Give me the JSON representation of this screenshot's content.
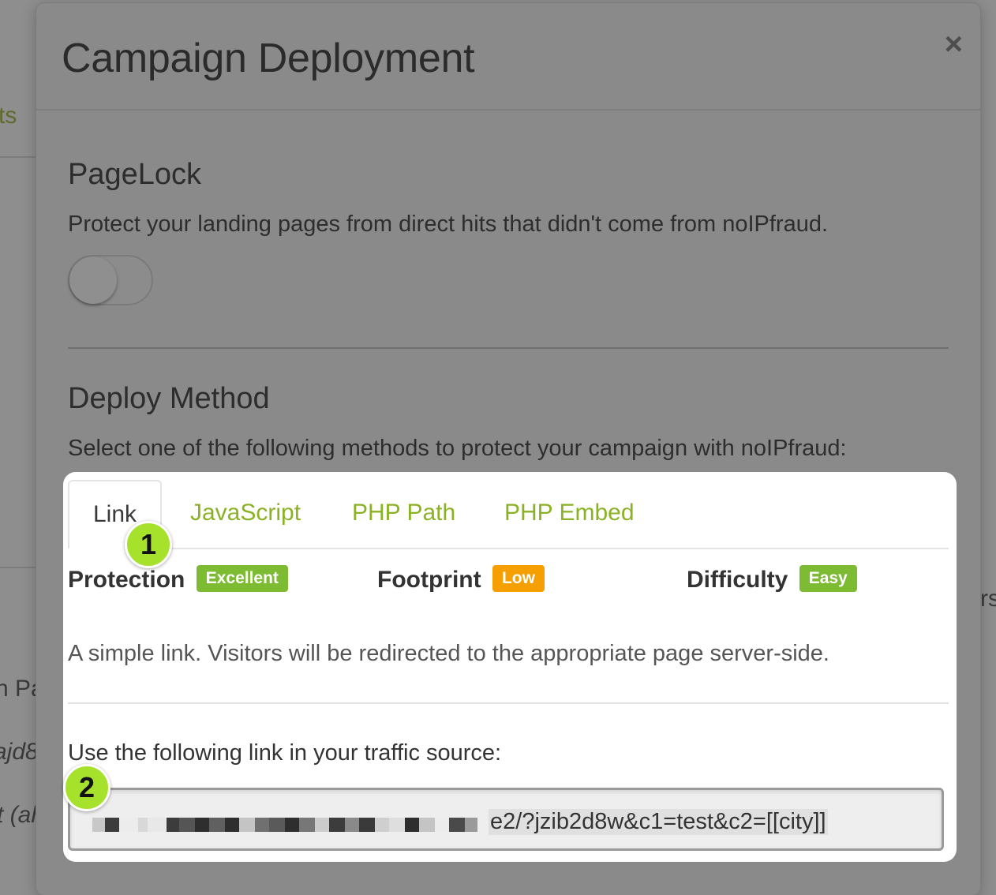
{
  "background": {
    "fragments": [
      "ts",
      "h Pa",
      "ajd8",
      "t (ah",
      "rs"
    ]
  },
  "modal": {
    "title": "Campaign Deployment",
    "close_icon": "×",
    "pagelock": {
      "heading": "PageLock",
      "description": "Protect your landing pages from direct hits that didn't come from noIPfraud.",
      "toggle_on": false
    },
    "deploy": {
      "heading": "Deploy Method",
      "description": "Select one of the following methods to protect your campaign with noIPfraud:"
    }
  },
  "panel": {
    "tabs": [
      {
        "label": "Link",
        "active": true
      },
      {
        "label": "JavaScript",
        "active": false
      },
      {
        "label": "PHP Path",
        "active": false
      },
      {
        "label": "PHP Embed",
        "active": false
      }
    ],
    "metrics": [
      {
        "label": "Protection",
        "badge": "Excellent",
        "color": "#7dbb33"
      },
      {
        "label": "Footprint",
        "badge": "Low",
        "color": "#f5a000"
      },
      {
        "label": "Difficulty",
        "badge": "Easy",
        "color": "#7dbb33"
      }
    ],
    "description": "A simple link. Visitors will be redirected to the appropriate page server-side.",
    "link_label": "Use the following link in your traffic source:",
    "link_value_visible": "e2/?jzib2d8w&c1=test&c2=[[city]]"
  },
  "markers": [
    "1",
    "2"
  ],
  "colors": {
    "accent_green": "#8bb225",
    "marker_green": "#a6e12b"
  }
}
